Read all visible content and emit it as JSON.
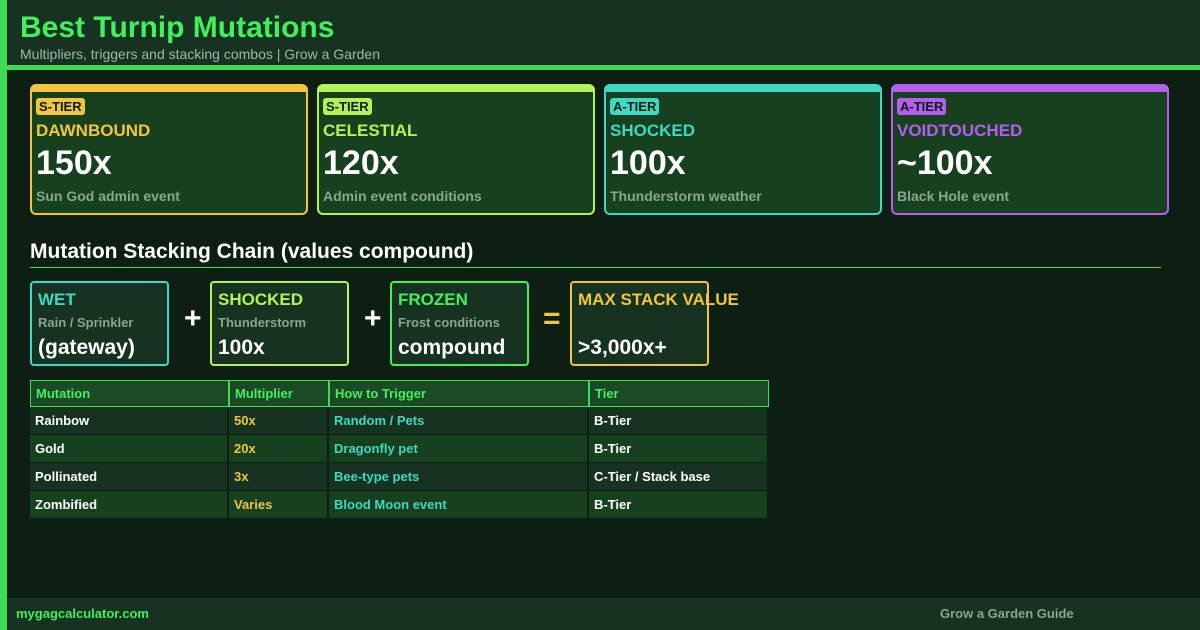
{
  "header": {
    "title": "Best Turnip Mutations",
    "subtitle": "Multipliers, triggers and stacking combos  |  Grow a Garden"
  },
  "cards": [
    {
      "tier": "S-TIER",
      "name": "DAWNBOUND",
      "multiplier": "150x",
      "description": "Sun God admin event",
      "color": "#f2c53d"
    },
    {
      "tier": "S-TIER",
      "name": "CELESTIAL",
      "multiplier": "120x",
      "description": "Admin event conditions",
      "color": "#b5f25a"
    },
    {
      "tier": "A-TIER",
      "name": "SHOCKED",
      "multiplier": "100x",
      "description": "Thunderstorm weather",
      "color": "#3ed8c3"
    },
    {
      "tier": "A-TIER",
      "name": "VOIDTOUCHED",
      "multiplier": "~100x",
      "description": "Black Hole event",
      "color": "#b45ef0"
    }
  ],
  "chain": {
    "title": "Mutation Stacking Chain  (values compound)",
    "steps": [
      {
        "name": "WET",
        "sub": "Rain / Sprinkler",
        "value": "(gateway)",
        "color": "#3ed8c3"
      },
      {
        "name": "SHOCKED",
        "sub": "Thunderstorm",
        "value": "100x",
        "color": "#b5f25a"
      },
      {
        "name": "FROZEN",
        "sub": "Frost conditions",
        "value": "compound",
        "color": "#42f05c"
      }
    ],
    "operators": [
      "+",
      "+",
      "="
    ],
    "result": {
      "name": "MAX STACK VALUE",
      "sub": "",
      "value": ">3,000x+",
      "color": "#f2c53d"
    }
  },
  "table": {
    "headers": [
      "Mutation",
      "Multiplier",
      "How to Trigger",
      "Tier"
    ],
    "rows": [
      [
        "Rainbow",
        "50x",
        "Random / Pets",
        "B-Tier"
      ],
      [
        "Gold",
        "20x",
        "Dragonfly pet",
        "B-Tier"
      ],
      [
        "Pollinated",
        "3x",
        "Bee-type pets",
        "C-Tier / Stack base"
      ],
      [
        "Zombified",
        "Varies",
        "Blood Moon event",
        "B-Tier"
      ]
    ]
  },
  "footer": {
    "site": "mygagcalculator.com",
    "guide": "Grow a Garden Guide"
  }
}
